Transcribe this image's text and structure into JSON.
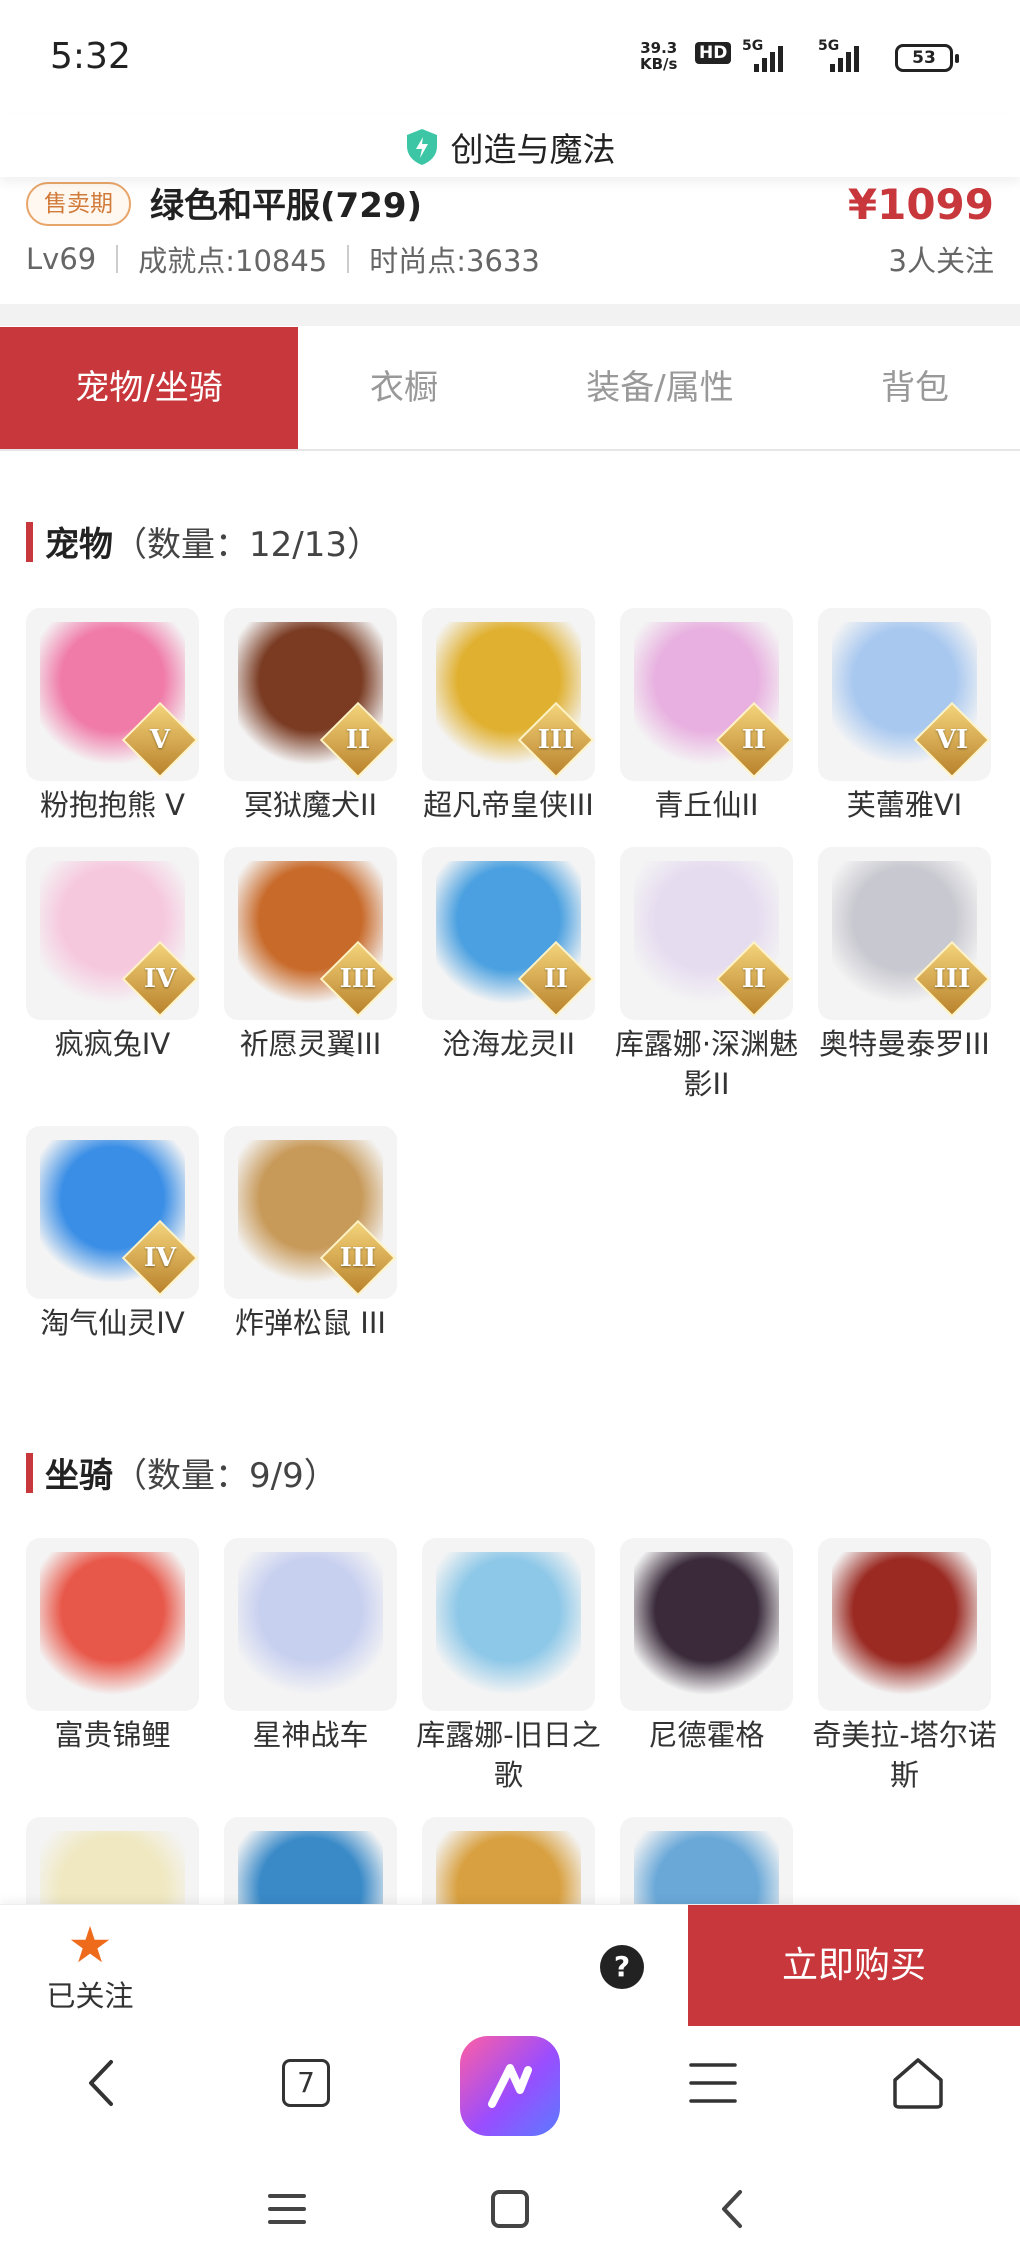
{
  "status_bar": {
    "time": "5:32",
    "net_speed_value": "39.3",
    "net_speed_unit": "KB/s",
    "hd_label": "HD",
    "sig1_label": "5G",
    "sig2_label": "5G",
    "battery": "53"
  },
  "title_bar": {
    "title": "创造与魔法",
    "icon": "shield-icon"
  },
  "listing": {
    "status_tag": "售卖期",
    "name": "绿色和平服(729)",
    "price": "¥1099",
    "level": "Lv69",
    "achievement": "成就点:10845",
    "fashion": "时尚点:3633",
    "followers": "3人关注"
  },
  "tabs": [
    {
      "label": "宠物/坐骑",
      "active": true
    },
    {
      "label": "衣橱",
      "active": false
    },
    {
      "label": "装备/属性",
      "active": false
    },
    {
      "label": "背包",
      "active": false
    }
  ],
  "pets": {
    "title": "宠物",
    "count": "（数量：12/13）",
    "items": [
      {
        "name": "粉抱抱熊 V",
        "rank": "V",
        "color": "#f07aa8"
      },
      {
        "name": "冥狱魔犬II",
        "rank": "II",
        "color": "#7a3b22"
      },
      {
        "name": "超凡帝皇侠III",
        "rank": "III",
        "color": "#e0b030"
      },
      {
        "name": "青丘仙II",
        "rank": "II",
        "color": "#e8b0e0"
      },
      {
        "name": "芙蕾雅VI",
        "rank": "VI",
        "color": "#a8c8f0"
      },
      {
        "name": "疯疯兔IV",
        "rank": "IV",
        "color": "#f6c8de"
      },
      {
        "name": "祈愿灵翼III",
        "rank": "III",
        "color": "#c86a2a"
      },
      {
        "name": "沧海龙灵II",
        "rank": "II",
        "color": "#4aa0e0"
      },
      {
        "name": "库露娜·深渊魅影II",
        "rank": "II",
        "color": "#e6dcf0"
      },
      {
        "name": "奥特曼泰罗III",
        "rank": "III",
        "color": "#c8c8d0"
      },
      {
        "name": "淘气仙灵IV",
        "rank": "IV",
        "color": "#3a8ee6"
      },
      {
        "name": "炸弹松鼠 III",
        "rank": "III",
        "color": "#c89a5a"
      }
    ]
  },
  "mounts": {
    "title": "坐骑",
    "count": "（数量：9/9）",
    "items": [
      {
        "name": "富贵锦鲤",
        "color": "#e8584a"
      },
      {
        "name": "星神战车",
        "color": "#c8d0f0"
      },
      {
        "name": "库露娜-旧日之歌",
        "color": "#8ec8e8"
      },
      {
        "name": "尼德霍格",
        "color": "#3a2a3a"
      },
      {
        "name": "奇美拉-塔尔诺斯",
        "color": "#9a2a22"
      },
      {
        "name": "",
        "color": "#f0e8c0"
      },
      {
        "name": "",
        "color": "#3a8ac8"
      },
      {
        "name": "",
        "color": "#d8a040"
      },
      {
        "name": "",
        "color": "#6aa8d8"
      }
    ]
  },
  "action_bar": {
    "follow_label": "已关注",
    "help_label": "?",
    "buy_label": "立即购买"
  },
  "browser_nav": {
    "tab_count": "7"
  }
}
